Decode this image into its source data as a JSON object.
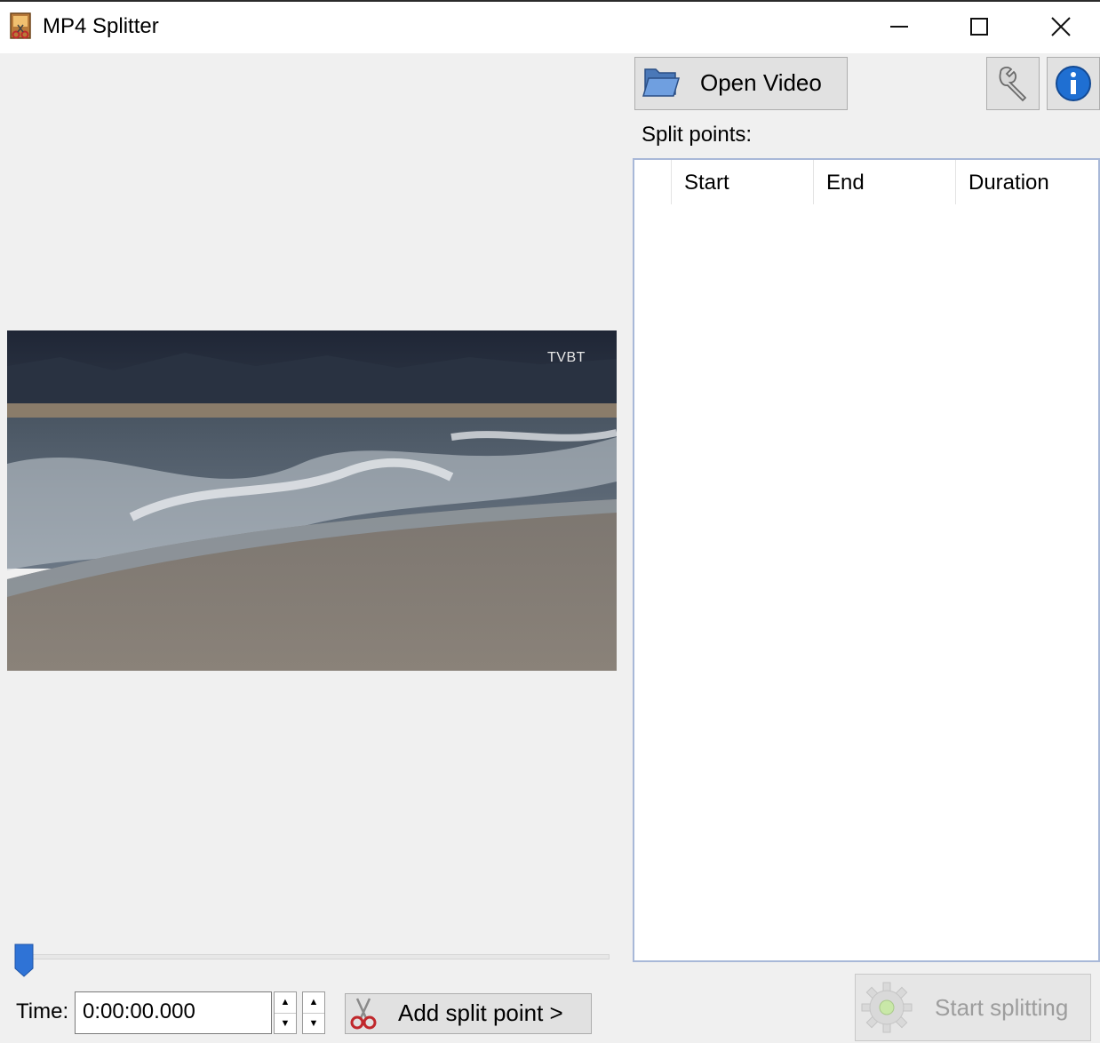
{
  "window": {
    "title": "MP4 Splitter",
    "controls": [
      "minimize",
      "maximize",
      "close"
    ]
  },
  "video": {
    "watermark": "TVBT"
  },
  "toolbar": {
    "open_label": "Open Video",
    "settings_icon": "wrench-icon",
    "info_icon": "info-icon"
  },
  "split_points": {
    "label": "Split points:",
    "columns": [
      "",
      "Start",
      "End",
      "Duration"
    ],
    "rows": []
  },
  "timeline": {
    "position_fraction": 0
  },
  "time": {
    "label": "Time:",
    "value": "0:00:00.000"
  },
  "actions": {
    "add_split_label": "Add split point >",
    "start_label": "Start splitting"
  },
  "colors": {
    "accent": "#2f73d6",
    "list_border": "#a8b8d8",
    "disabled_text": "#9d9d9d"
  }
}
